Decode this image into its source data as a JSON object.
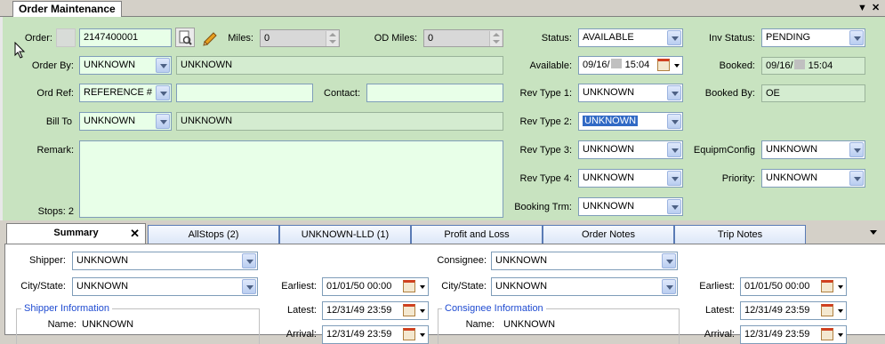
{
  "window": {
    "tab_title": "Order Maintenance",
    "pin_icon": "pin-down-icon",
    "close_icon": "close-icon"
  },
  "order": {
    "order_label": "Order:",
    "order_number": "2147400001",
    "miles_label": "Miles:",
    "miles_value": "0",
    "od_miles_label": "OD Miles:",
    "od_miles_value": "0",
    "order_by_label": "Order By:",
    "order_by_value": "UNKNOWN",
    "order_by_name": "UNKNOWN",
    "ord_ref_label": "Ord Ref:",
    "ord_ref_value": "REFERENCE #",
    "ord_ref_text": "",
    "contact_label": "Contact:",
    "contact_value": "",
    "bill_to_label": "Bill To",
    "bill_to_value": "UNKNOWN",
    "bill_to_name": "UNKNOWN",
    "remark_label": "Remark:",
    "remark_value": "",
    "stops_label": "Stops: 2"
  },
  "status": {
    "status_label": "Status:",
    "status_value": "AVAILABLE",
    "available_label": "Available:",
    "available_date": "09/16/",
    "available_time": "15:04",
    "rev1_label": "Rev Type 1:",
    "rev1_value": "UNKNOWN",
    "rev2_label": "Rev Type 2:",
    "rev2_value": "UNKNOWN",
    "rev3_label": "Rev Type 3:",
    "rev3_value": "UNKNOWN",
    "rev4_label": "Rev Type 4:",
    "rev4_value": "UNKNOWN",
    "booking_label": "Booking Trm:",
    "booking_value": "UNKNOWN"
  },
  "inv": {
    "inv_status_label": "Inv Status:",
    "inv_status_value": "PENDING",
    "booked_label": "Booked:",
    "booked_date": "09/16/",
    "booked_time": "15:04",
    "booked_by_label": "Booked By:",
    "booked_by_value": "OE",
    "equip_label": "EquipmConfig",
    "equip_value": "UNKNOWN",
    "priority_label": "Priority:",
    "priority_value": "UNKNOWN"
  },
  "tabs": [
    {
      "label": "Summary"
    },
    {
      "label": "AllStops (2)"
    },
    {
      "label": "UNKNOWN-LLD (1)"
    },
    {
      "label": "Profit and Loss"
    },
    {
      "label": "Order Notes"
    },
    {
      "label": "Trip Notes"
    }
  ],
  "summary": {
    "shipper_label": "Shipper:",
    "shipper_value": "UNKNOWN",
    "shipper_city_label": "City/State:",
    "shipper_city_value": "UNKNOWN",
    "shipper_info_title": "Shipper Information",
    "shipper_name_label": "Name:",
    "shipper_name_value": "UNKNOWN",
    "s_earliest_label": "Earliest:",
    "s_earliest_value": "01/01/50 00:00",
    "s_latest_label": "Latest:",
    "s_latest_value": "12/31/49 23:59",
    "s_arrival_label": "Arrival:",
    "s_arrival_value": "12/31/49 23:59",
    "consignee_label": "Consignee:",
    "consignee_value": "UNKNOWN",
    "consignee_city_label": "City/State:",
    "consignee_city_value": "UNKNOWN",
    "consignee_info_title": "Consignee Information",
    "consignee_name_label": "Name:",
    "consignee_name_value": "UNKNOWN",
    "c_earliest_label": "Earliest:",
    "c_earliest_value": "01/01/50 00:00",
    "c_latest_label": "Latest:",
    "c_latest_value": "12/31/49 23:59",
    "c_arrival_label": "Arrival:",
    "c_arrival_value": "12/31/49 23:59"
  }
}
